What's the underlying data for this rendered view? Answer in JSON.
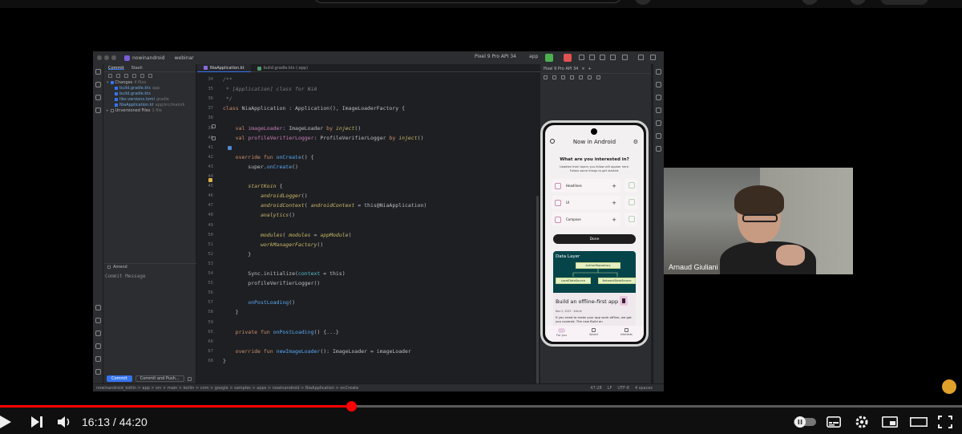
{
  "ide": {
    "project": "nowinandroid",
    "branch": "webinar",
    "device": "Pixel 9 Pro API 34",
    "run_config": "app",
    "commit_tabs": [
      "Commit",
      "Stash"
    ],
    "changes_label": "Changes",
    "changes_count": "4 files",
    "changed_files": [
      {
        "name": "build.gradle.kts",
        "path": "app"
      },
      {
        "name": "build.gradle.kts",
        "path": ""
      },
      {
        "name": "libs.versions.toml",
        "path": "gradle"
      },
      {
        "name": "NiaApplication.kt",
        "path": "app/src/main/kotlin/com"
      }
    ],
    "unversioned_label": "Unversioned Files",
    "unversioned_count": "1 file",
    "amend_label": "Amend",
    "commit_message_placeholder": "Commit Message",
    "commit_button": "Commit",
    "commit_push_button": "Commit and Push...",
    "editor_tabs": [
      "NiaApplication.kt",
      "build.gradle.kts (:app)"
    ],
    "preview_device": "Pixel 9 Pro API 34",
    "breadcrumb": "nowinandroid_kotlin > app > src > main > kotlin > com > google > samples > apps > nowinandroid > NiaApplication > onCreate",
    "status_position": "47:28",
    "status_lf": "LF",
    "status_encoding": "UTF-8",
    "status_indent": "4 spaces"
  },
  "code_lines": [
    {
      "n": "34",
      "t": "/**"
    },
    {
      "n": "35",
      "t": " * [Application] class for NiA"
    },
    {
      "n": "36",
      "t": " */"
    },
    {
      "n": "37",
      "t": "class NiaApplication : Application(), ImageLoaderFactory {"
    },
    {
      "n": "38",
      "t": ""
    },
    {
      "n": "39",
      "t": "    val imageLoader: ImageLoader by inject()"
    },
    {
      "n": "40",
      "t": "    val profileVerifierLogger: ProfileVerifierLogger by inject()"
    },
    {
      "n": "41",
      "t": ""
    },
    {
      "n": "42",
      "t": "    override fun onCreate() {"
    },
    {
      "n": "43",
      "t": "        super.onCreate()"
    },
    {
      "n": "44",
      "t": ""
    },
    {
      "n": "45",
      "t": "        startKoin {"
    },
    {
      "n": "46",
      "t": "            androidLogger()"
    },
    {
      "n": "47",
      "t": "            androidContext( androidContext = this@NiaApplication)"
    },
    {
      "n": "48",
      "t": "            analytics()"
    },
    {
      "n": "49",
      "t": ""
    },
    {
      "n": "50",
      "t": "            modules( modules = appModule)"
    },
    {
      "n": "51",
      "t": "            workManagerFactory()"
    },
    {
      "n": "52",
      "t": "        }"
    },
    {
      "n": "53",
      "t": ""
    },
    {
      "n": "54",
      "t": "        Sync.initialize(context = this)"
    },
    {
      "n": "55",
      "t": "        profileVerifierLogger()"
    },
    {
      "n": "56",
      "t": ""
    },
    {
      "n": "57",
      "t": "        onPostLoading()"
    },
    {
      "n": "58",
      "t": "    }"
    },
    {
      "n": "59",
      "t": ""
    },
    {
      "n": "65",
      "t": "    private fun onPostLoading() {...}"
    },
    {
      "n": "66",
      "t": ""
    },
    {
      "n": "67",
      "t": "    override fun newImageLoader(): ImageLoader = imageLoader"
    },
    {
      "n": "68",
      "t": "}"
    }
  ],
  "phone": {
    "app_title": "Now in Android",
    "question": "What are you interested in?",
    "description": "Updates from topics you follow will appear here. Follow some things to get started.",
    "topics": [
      "Headlines",
      "UI",
      "Compose"
    ],
    "done_button": "Done",
    "data_layer_title": "Data Layer",
    "author_repository": "AuthorRepository",
    "local_data_source": "LocalDataSource",
    "network_data_source": "NetworkDataSource",
    "article_title": "Build an offline-first app",
    "article_meta": "Nov 5, 2023 · Article",
    "article_body": "If you need to make your app work offline, we got you covered. The new Build an",
    "nav": [
      "For you",
      "Saved",
      "Interests"
    ]
  },
  "webcam": {
    "name": "Arnaud Giuliani"
  },
  "player": {
    "current_time": "16:13",
    "duration": "44:20",
    "time_display": "16:13 / 44:20",
    "progress_fraction": 0.3658,
    "buffer_fraction": 0.37,
    "colors": {
      "played": "#ff0000",
      "track": "#5a5a5a",
      "buffer": "#9a9a9a"
    },
    "icons": [
      "play-icon",
      "next-icon",
      "volume-icon",
      "autoplay-toggle-icon",
      "subtitles-icon",
      "settings-icon",
      "miniplayer-icon",
      "theater-icon",
      "fullscreen-icon"
    ]
  }
}
